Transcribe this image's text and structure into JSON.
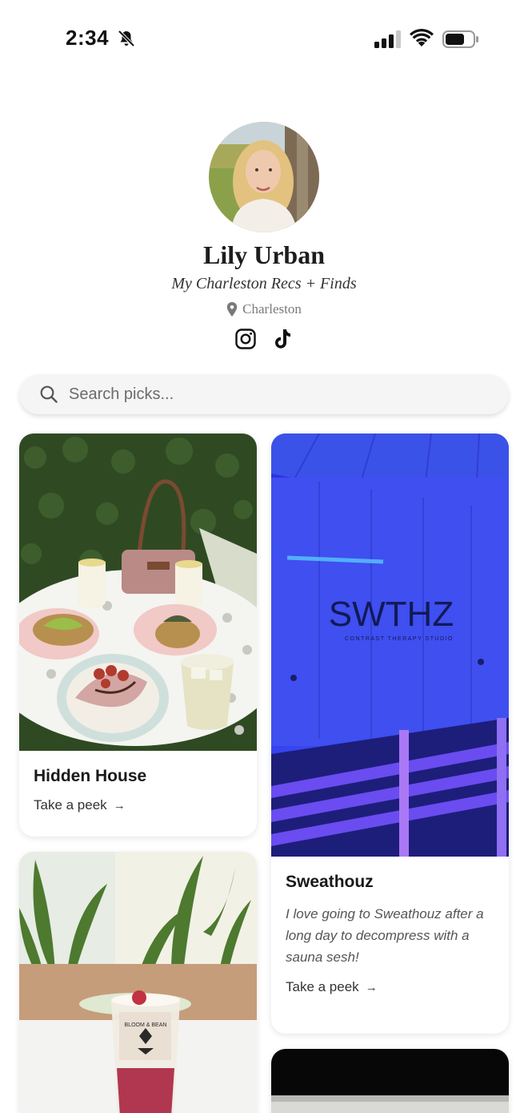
{
  "status_bar": {
    "time": "2:34"
  },
  "profile": {
    "name": "Lily Urban",
    "tagline": "My Charleston Recs + Finds",
    "location": "Charleston",
    "socials": [
      "instagram-icon",
      "tiktok-icon"
    ]
  },
  "search": {
    "placeholder": "Search picks..."
  },
  "cards": [
    {
      "title": "Hidden House",
      "description": "",
      "link": "Take a peek",
      "arrow": "→"
    },
    {
      "title": "Sweathouz",
      "description": "I love going to Sweathouz after a long day to decompress with a sauna sesh!",
      "link": "Take a peek",
      "arrow": "→",
      "image_text": "SWTHZ",
      "image_subtext": "CONTRAST THERAPY STUDIO"
    },
    {
      "title": "",
      "description": "",
      "link": "",
      "image_text": "BLOOM & BEAN"
    },
    {
      "title": "",
      "description": "",
      "link": ""
    }
  ]
}
